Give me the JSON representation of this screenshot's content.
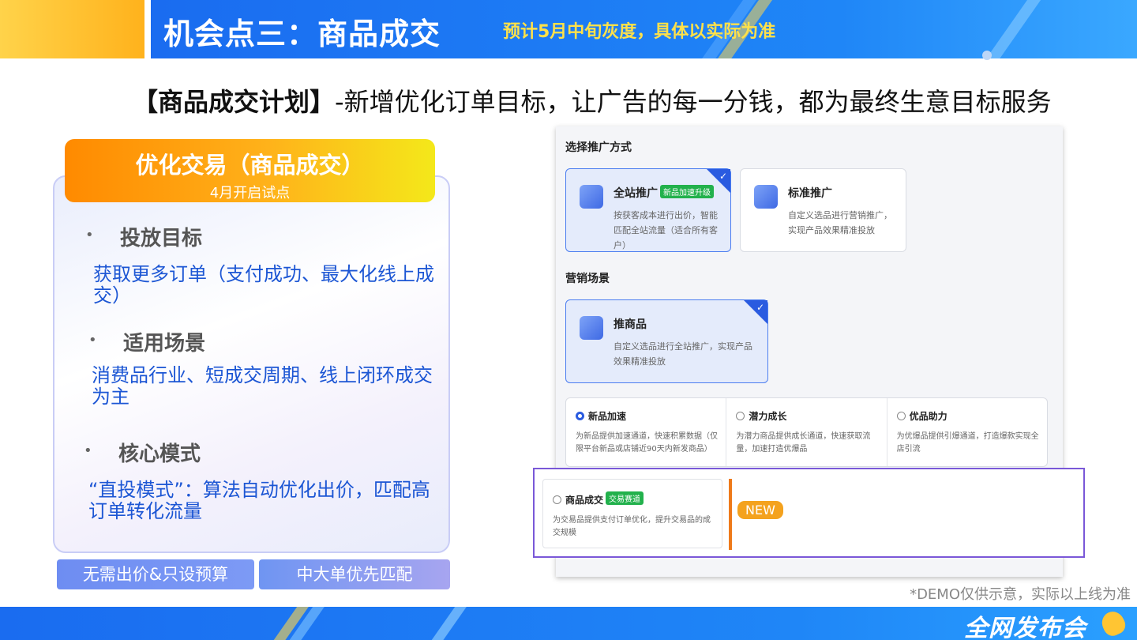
{
  "header": {
    "title": "机会点三：商品成交",
    "subtitle": "预计5月中旬灰度，具体以实际为准"
  },
  "headline": {
    "bold": "【商品成交计划】",
    "rest": "-新增优化订单目标，让广告的每一分钱，都为最终生意目标服务"
  },
  "card": {
    "banner_title": "优化交易（商品成交）",
    "banner_sub": "4月开启试点",
    "bullet": "•",
    "sections": [
      {
        "title": "投放目标",
        "desc": "获取更多订单（支付成功、最大化线上成交）"
      },
      {
        "title": "适用场景",
        "desc": "消费品行业、短成交周期、线上闭环成交为主"
      },
      {
        "title": "核心模式",
        "desc": "“直投模式”：算法自动优化出价，匹配高订单转化流量"
      }
    ]
  },
  "pills": [
    "无需出价&只设预算",
    "中大单优先匹配"
  ],
  "screenshot": {
    "promo_label": "选择推广方式",
    "promo_options": [
      {
        "title": "全站推广",
        "tag": "新品加速升级",
        "desc": "按获客成本进行出价，智能匹配全站流量（适合所有客户）"
      },
      {
        "title": "标准推广",
        "desc": "自定义选品进行营销推广，实现产品效果精准投放"
      }
    ],
    "scene_label": "营销场景",
    "scene_option": {
      "title": "推商品",
      "desc": "自定义选品进行全站推广，实现产品效果精准投放"
    },
    "checkmark": "✓",
    "sub_options": [
      {
        "title": "新品加速",
        "desc": "为新品提供加速通道，快速积累数据（仅限平台新品或店铺近90天内新发商品）"
      },
      {
        "title": "潜力成长",
        "desc": "为潜力商品提供成长通道，快速获取流量，加速打造优爆品"
      },
      {
        "title": "优品助力",
        "desc": "为优爆品提供引爆通道，打造爆款实现全店引流"
      }
    ],
    "new_option": {
      "title": "商品成交",
      "tag": "交易赛道",
      "desc": "为交易品提供支付订单优化，提升交易品的成交规模"
    },
    "new_badge": "NEW"
  },
  "demo_note": "*DEMO仅供示意，实际以上线为准",
  "footer_logo": "全网发布会"
}
